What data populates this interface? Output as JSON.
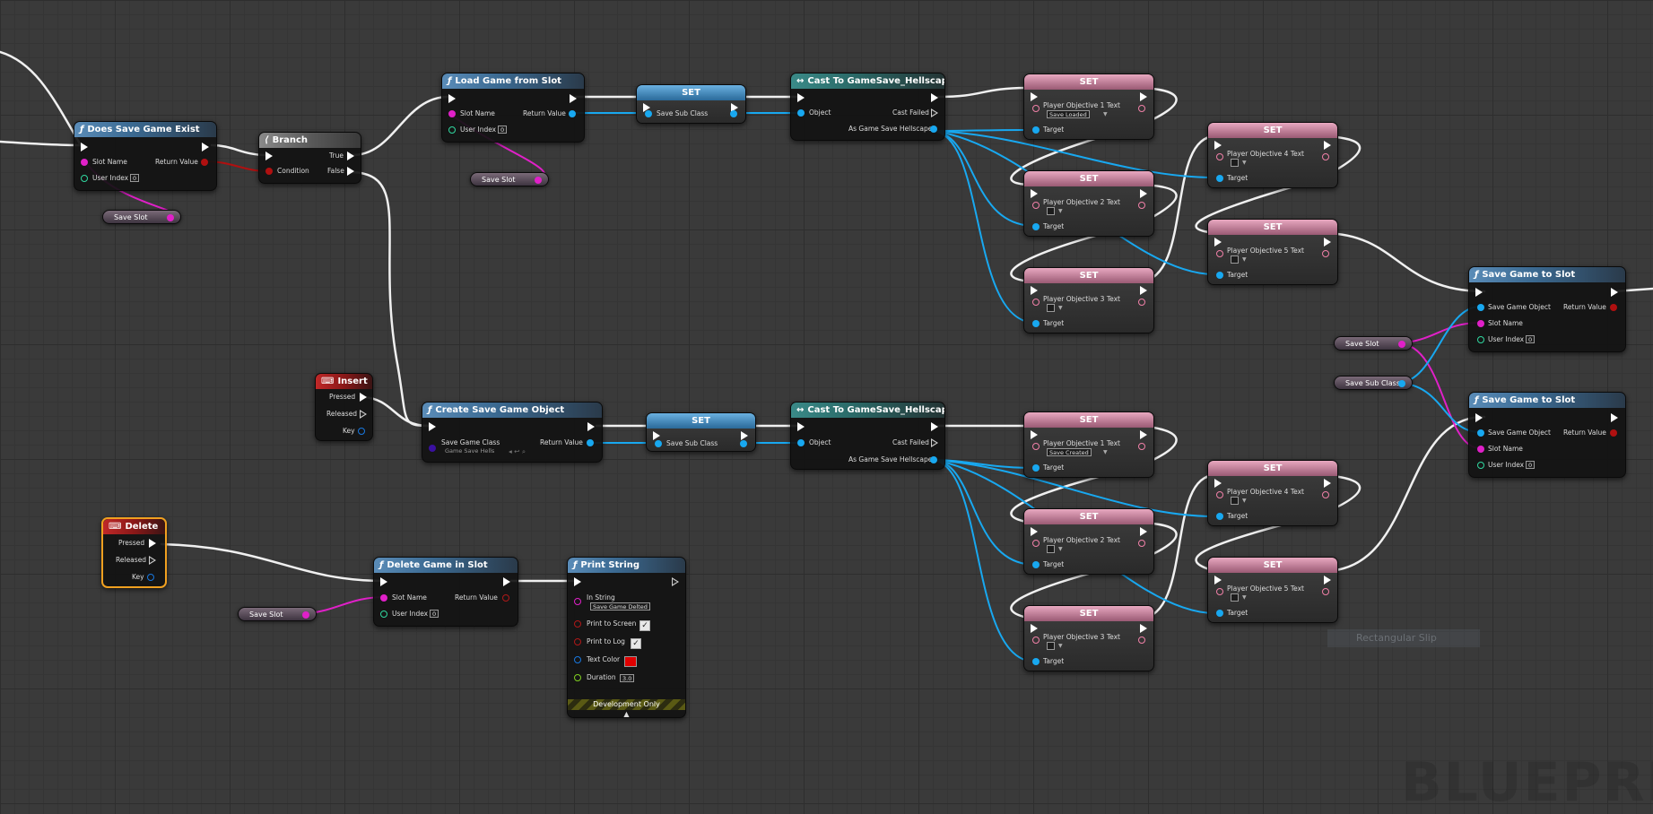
{
  "func_icon": "ƒ",
  "event_icon": "⌨",
  "branch_icon": "⟨",
  "cast_icon": "↔",
  "nodes": {
    "does_save_game_exist": {
      "title": "Does Save Game Exist",
      "slot_name": "Slot Name",
      "return_value": "Return Value",
      "user_index": "User Index",
      "user_index_value": "0"
    },
    "branch": {
      "title": "Branch",
      "true": "True",
      "false": "False",
      "condition": "Condition"
    },
    "load_game_from_slot": {
      "title": "Load Game from Slot",
      "slot_name": "Slot Name",
      "return_value": "Return Value",
      "user_index": "User Index",
      "user_index_value": "0"
    },
    "set_top": {
      "title": "SET",
      "pin": "Save Sub Class"
    },
    "cast_top": {
      "title": "Cast To GameSave_Hellscape",
      "object": "Object",
      "cast_failed": "Cast Failed",
      "as_game": "As Game Save Hellscape"
    },
    "insert": {
      "title": "Insert",
      "pressed": "Pressed",
      "released": "Released",
      "key": "Key"
    },
    "create_save_game_object": {
      "title": "Create Save Game Object",
      "save_game_class": "Save Game Class",
      "class_value": "Game Save Hells",
      "return_value": "Return Value"
    },
    "set_mid": {
      "title": "SET",
      "pin": "Save Sub Class"
    },
    "cast_bottom": {
      "title": "Cast To GameSave_Hellscape",
      "object": "Object",
      "cast_failed": "Cast Failed",
      "as_game": "As Game Save Hellscape"
    },
    "delete": {
      "title": "Delete",
      "pressed": "Pressed",
      "released": "Released",
      "key": "Key"
    },
    "delete_game_in_slot": {
      "title": "Delete Game in Slot",
      "slot_name": "Slot Name",
      "return_value": "Return Value",
      "user_index": "User Index",
      "user_index_value": "0"
    },
    "print_string": {
      "title": "Print String",
      "in_string": "In String",
      "in_string_value": "Save Game Delted",
      "print_to_screen": "Print to Screen",
      "print_to_log": "Print to Log",
      "text_color": "Text Color",
      "duration": "Duration",
      "duration_value": "3.0",
      "dev_only": "Development Only",
      "expand": "▲"
    },
    "save_game_to_slot_1": {
      "title": "Save Game to Slot",
      "save_game_object": "Save Game Object",
      "return_value": "Return Value",
      "slot_name": "Slot Name",
      "user_index": "User Index",
      "user_index_value": "0"
    },
    "save_game_to_slot_2": {
      "title": "Save Game to Slot",
      "save_game_object": "Save Game Object",
      "return_value": "Return Value",
      "slot_name": "Slot Name",
      "user_index": "User Index",
      "user_index_value": "0"
    }
  },
  "set_title": "SET",
  "target_label": "Target",
  "objective_sets": [
    {
      "label": "Player Objective 1 Text",
      "value": "Save Loaded"
    },
    {
      "label": "Player Objective 2 Text",
      "value": ""
    },
    {
      "label": "Player Objective 3 Text",
      "value": ""
    },
    {
      "label": "Player Objective 4 Text",
      "value": ""
    },
    {
      "label": "Player Objective 5 Text",
      "value": ""
    },
    {
      "label": "Player Objective 1 Text",
      "value": "Save Created"
    },
    {
      "label": "Player Objective 2 Text",
      "value": ""
    },
    {
      "label": "Player Objective 3 Text",
      "value": ""
    },
    {
      "label": "Player Objective 4 Text",
      "value": ""
    },
    {
      "label": "Player Objective 5 Text",
      "value": ""
    }
  ],
  "variables": {
    "save_slot": "Save Slot",
    "save_sub_class": "Save Sub Class"
  },
  "faded_node": "Rectangular Slip",
  "watermark": "BLUEPRINT",
  "colors": {
    "exec": "#ffffff",
    "string_pin": "#e020c8",
    "object_pin": "#18a8f0",
    "bool_pin": "#b01010",
    "int_pin": "#30d8a0",
    "text_pin": "#f080a8"
  }
}
